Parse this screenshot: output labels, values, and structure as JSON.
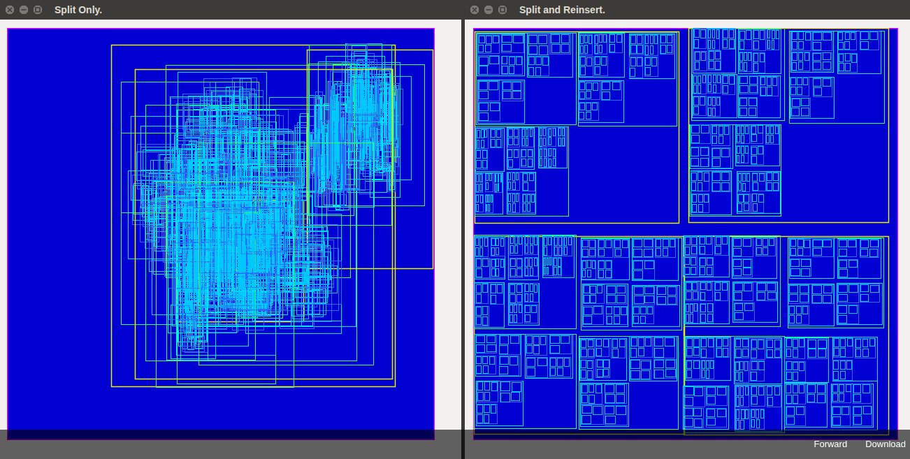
{
  "windows": [
    {
      "title": "Split Only.",
      "style": "split"
    },
    {
      "title": "Split and Reinsert.",
      "style": "reinsert"
    }
  ],
  "overlay": {
    "actions": [
      "Forward",
      "Download"
    ]
  }
}
